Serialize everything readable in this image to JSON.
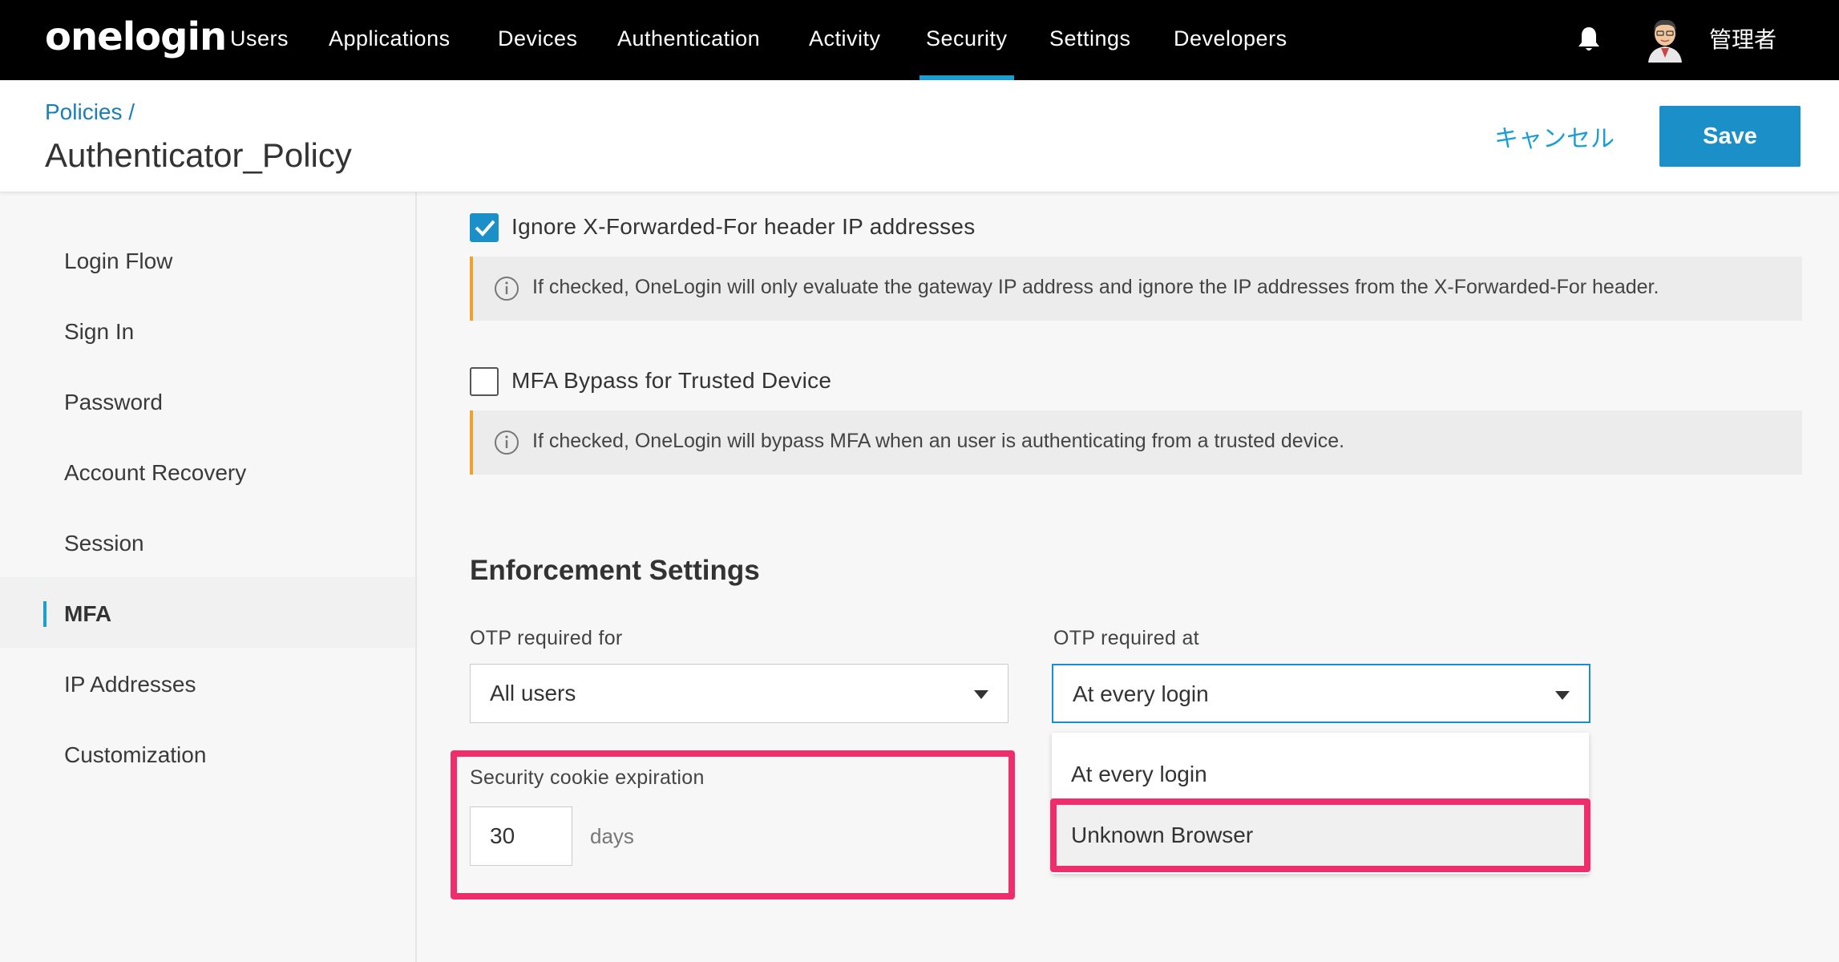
{
  "brand": {
    "logo": "onelogin",
    "accent": "#1a9ed4",
    "highlight": "#f02d6c"
  },
  "nav": {
    "items": [
      {
        "label": "Users"
      },
      {
        "label": "Applications"
      },
      {
        "label": "Devices"
      },
      {
        "label": "Authentication"
      },
      {
        "label": "Activity"
      },
      {
        "label": "Security",
        "active": true
      },
      {
        "label": "Settings"
      },
      {
        "label": "Developers"
      }
    ],
    "user_name": "管理者",
    "icons": [
      "bell-icon",
      "avatar"
    ]
  },
  "header": {
    "breadcrumb": "Policies /",
    "title": "Authenticator_Policy",
    "cancel_label": "キャンセル",
    "save_label": "Save"
  },
  "sidebar": {
    "items": [
      {
        "label": "Login Flow"
      },
      {
        "label": "Sign In"
      },
      {
        "label": "Password"
      },
      {
        "label": "Account Recovery"
      },
      {
        "label": "Session"
      },
      {
        "label": "MFA",
        "active": true
      },
      {
        "label": "IP Addresses"
      },
      {
        "label": "Customization"
      }
    ]
  },
  "main": {
    "ignore_xff": {
      "checked": true,
      "label": "Ignore X-Forwarded-For header IP addresses",
      "info": "If checked, OneLogin will only evaluate the gateway IP address and ignore the IP addresses from the X-Forwarded-For header."
    },
    "mfa_bypass": {
      "checked": false,
      "label": "MFA Bypass for Trusted Device",
      "info": "If checked, OneLogin will bypass MFA when an user is authenticating from a trusted device."
    },
    "enforcement": {
      "title": "Enforcement Settings",
      "otp_for_label": "OTP required for",
      "otp_for_value": "All users",
      "otp_at_label": "OTP required at",
      "otp_at_value": "At every login",
      "otp_at_options": [
        "At every login",
        "Unknown Browser"
      ],
      "cookie_label": "Security cookie expiration",
      "cookie_value": "30",
      "cookie_unit": "days"
    }
  }
}
